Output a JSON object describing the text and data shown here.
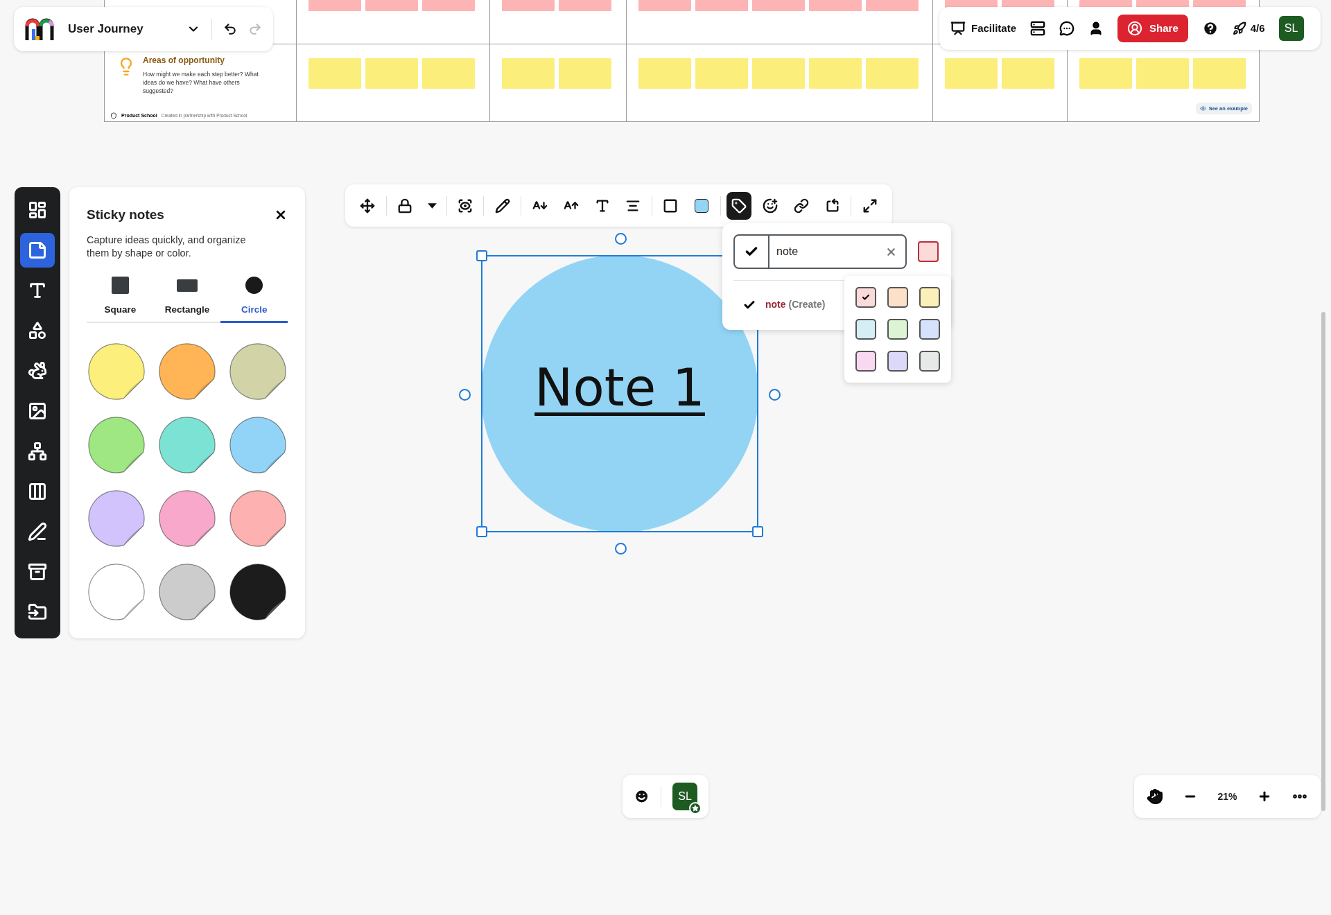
{
  "board": {
    "rows": [
      {
        "cells": [
          {},
          {
            "notes": [
              {
                "color": "#fdb4b4"
              },
              {
                "color": "#fdb4b4"
              },
              {
                "color": "#fdb4b4"
              }
            ]
          },
          {
            "notes": [
              {
                "color": "#fdb4b4"
              },
              {
                "color": "#fdb4b4"
              }
            ]
          },
          {
            "notes": [
              {
                "color": "#fdb4b4"
              },
              {
                "color": "#fdb4b4"
              },
              {
                "color": "#fdb4b4"
              },
              {
                "color": "#fdb4b4"
              },
              {
                "color": "#fdb4b4"
              }
            ]
          },
          {
            "notes": [
              {
                "color": "#fdb4b4"
              },
              {
                "color": "#fdb4b4"
              }
            ]
          },
          {
            "notes": [
              {
                "color": "#fdb4b4"
              },
              {
                "color": "#fdb4b4"
              },
              {
                "color": "#fdb4b4"
              }
            ]
          }
        ]
      },
      {
        "header": {
          "title": "Areas of opportunity",
          "body": "How might we make each step better? What ideas do we have? What have others suggested?",
          "brand": "Product School",
          "credit": "Created in partnership with Product School"
        },
        "cells": [
          {},
          {
            "notes": [
              {
                "color": "#fbee7a"
              },
              {
                "color": "#fbee7a"
              },
              {
                "color": "#fbee7a"
              }
            ]
          },
          {
            "notes": [
              {
                "color": "#fbee7a"
              },
              {
                "color": "#fbee7a"
              }
            ]
          },
          {
            "notes": [
              {
                "color": "#fbee7a"
              },
              {
                "color": "#fbee7a"
              },
              {
                "color": "#fbee7a"
              },
              {
                "color": "#fbee7a"
              },
              {
                "color": "#fbee7a"
              }
            ]
          },
          {
            "notes": [
              {
                "color": "#fbee7a"
              },
              {
                "color": "#fbee7a"
              }
            ]
          },
          {
            "notes": [
              {
                "color": "#fbee7a"
              },
              {
                "color": "#fbee7a"
              },
              {
                "color": "#fbee7a"
              }
            ]
          }
        ],
        "example_button": "See an example"
      }
    ]
  },
  "top_left": {
    "title": "User Journey",
    "undo_disabled": false,
    "redo_disabled": true
  },
  "top_right": {
    "facilitate": "Facilitate",
    "share": "Share",
    "progress": "4/6",
    "avatar": "SL"
  },
  "sidebar": {
    "items": [
      {
        "kind": "layout",
        "selected": false
      },
      {
        "kind": "sticky",
        "selected": true
      },
      {
        "kind": "text",
        "selected": false
      },
      {
        "kind": "shapes",
        "selected": false
      },
      {
        "kind": "animal",
        "selected": false
      },
      {
        "kind": "image",
        "selected": false
      },
      {
        "kind": "diagram",
        "selected": false
      },
      {
        "kind": "table",
        "selected": false
      },
      {
        "kind": "draw",
        "selected": false
      },
      {
        "kind": "archive",
        "selected": false
      },
      {
        "kind": "import",
        "selected": false
      }
    ]
  },
  "panel": {
    "title": "Sticky notes",
    "description": "Capture ideas quickly, and organize them by shape or color.",
    "tabs": [
      {
        "kind": "square",
        "label": "Square",
        "selected": false
      },
      {
        "kind": "rectangle",
        "label": "Rectangle",
        "selected": false
      },
      {
        "kind": "circle",
        "label": "Circle",
        "selected": true
      }
    ],
    "swatches": [
      {
        "color": "#fcef7c"
      },
      {
        "color": "#ffb456"
      },
      {
        "color": "#d3d3a8"
      },
      {
        "color": "#9fe783"
      },
      {
        "color": "#7ce3d4"
      },
      {
        "color": "#92d4f7"
      },
      {
        "color": "#d2c3fc"
      },
      {
        "color": "#f8a9cb"
      },
      {
        "color": "#fdb1b1"
      },
      {
        "color": "#ffffff"
      },
      {
        "color": "#cccccc"
      },
      {
        "color": "#1c1c1c"
      }
    ]
  },
  "toolbar": {
    "items": [
      {
        "kind": "move",
        "selected": false
      },
      {
        "kind": "divider"
      },
      {
        "kind": "lock",
        "selected": false
      },
      {
        "kind": "dropdown"
      },
      {
        "kind": "divider"
      },
      {
        "kind": "focus",
        "selected": false
      },
      {
        "kind": "divider"
      },
      {
        "kind": "pen",
        "selected": false
      },
      {
        "kind": "divider"
      },
      {
        "kind": "font-down",
        "selected": false
      },
      {
        "kind": "font-up",
        "selected": false
      },
      {
        "kind": "text",
        "selected": false
      },
      {
        "kind": "align",
        "selected": false
      },
      {
        "kind": "divider"
      },
      {
        "kind": "border",
        "selected": false
      },
      {
        "kind": "fill",
        "selected": false,
        "color": "#93d4f5"
      },
      {
        "kind": "divider"
      },
      {
        "kind": "tag",
        "selected": true
      },
      {
        "kind": "reaction",
        "selected": false
      },
      {
        "kind": "link",
        "selected": false
      },
      {
        "kind": "rotate",
        "selected": false
      },
      {
        "kind": "divider"
      },
      {
        "kind": "expand",
        "selected": false
      }
    ]
  },
  "note": {
    "text": "Note 1",
    "color": "#93d4f5",
    "selected": true
  },
  "tag_popup": {
    "value": "note",
    "suggestion": {
      "name": "note",
      "hint": "(Create)"
    },
    "palette": [
      {
        "color": "#fbdada",
        "selected": true
      },
      {
        "color": "#fde0c8",
        "selected": false
      },
      {
        "color": "#fbf0b8",
        "selected": false
      },
      {
        "color": "#d5eef6",
        "selected": false
      },
      {
        "color": "#dcf4d4",
        "selected": false
      },
      {
        "color": "#d6e2fb",
        "selected": false
      },
      {
        "color": "#f9d8f2",
        "selected": false
      },
      {
        "color": "#dcd8f8",
        "selected": false
      },
      {
        "color": "#e6e9e8",
        "selected": false
      }
    ]
  },
  "bottom": {
    "avatar": "SL",
    "zoom": "21%"
  }
}
